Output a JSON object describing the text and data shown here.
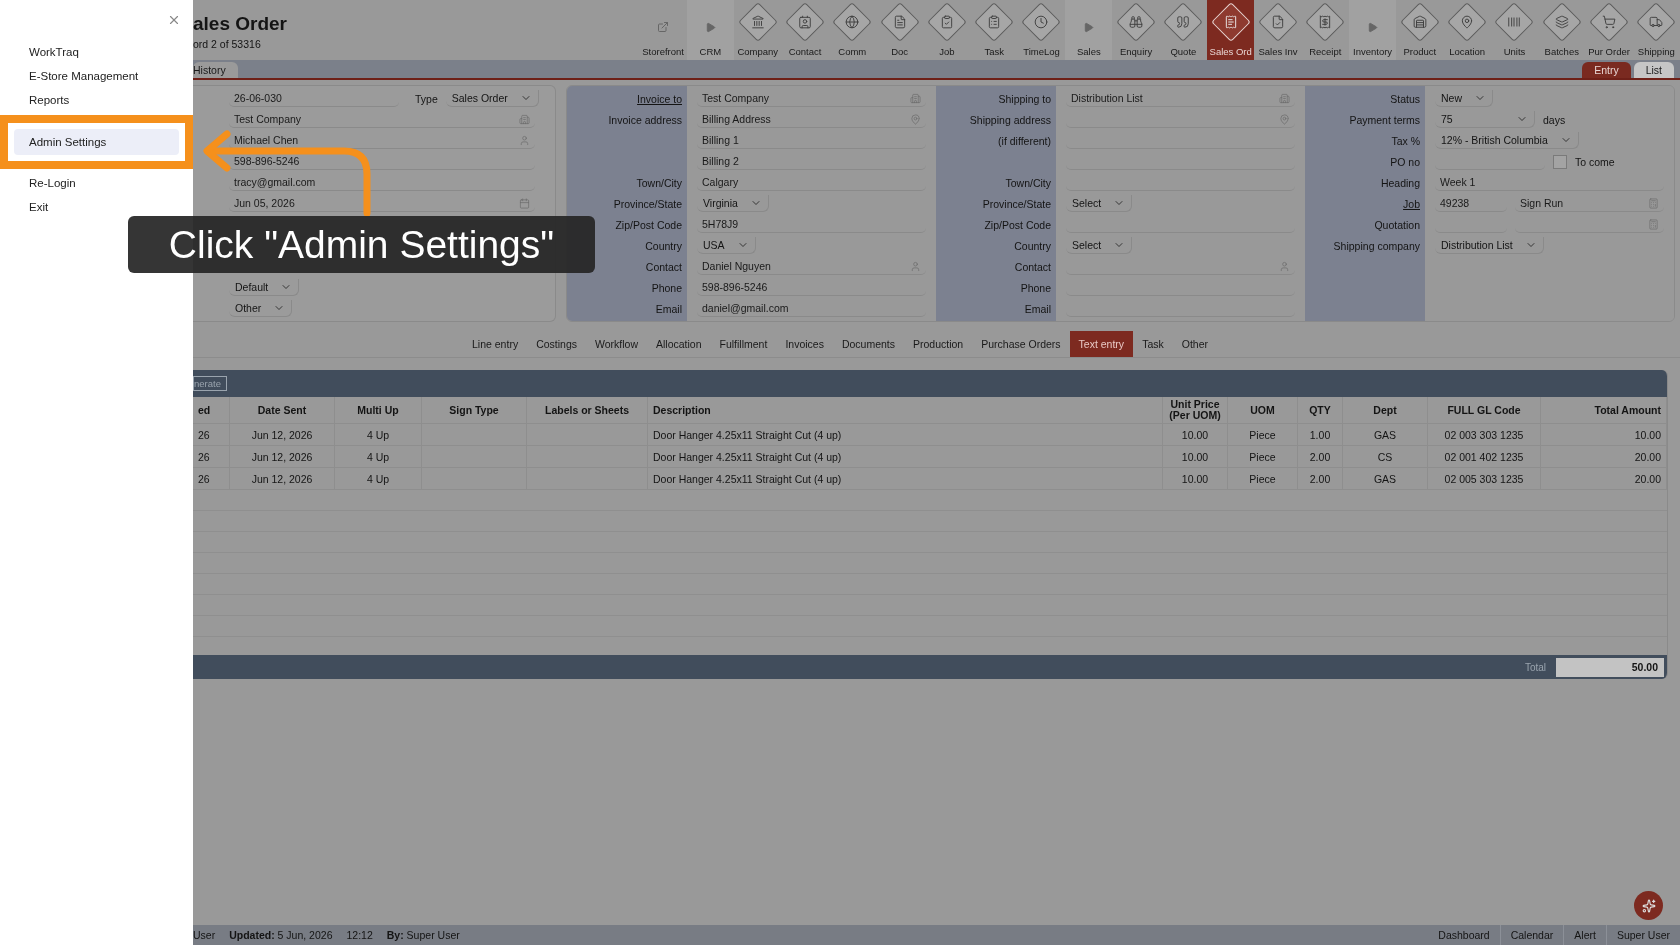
{
  "drawer": {
    "items": [
      {
        "label": "WorkTraq",
        "selected": false
      },
      {
        "label": "E-Store Management",
        "selected": false
      },
      {
        "label": "Reports",
        "selected": false
      },
      {
        "label": "Admin Settings",
        "selected": true
      },
      {
        "label": "Re-Login",
        "selected": false
      },
      {
        "label": "Exit",
        "selected": false
      }
    ]
  },
  "callout": {
    "text": "Click \"Admin Settings\""
  },
  "header": {
    "title": "ales Order",
    "subtitle": "ord 2 of 53316"
  },
  "toolbar": [
    {
      "label": "Storefront",
      "kind": "link",
      "selected": false
    },
    {
      "label": "CRM",
      "kind": "section",
      "selected": false
    },
    {
      "label": "Company",
      "kind": "module",
      "selected": false
    },
    {
      "label": "Contact",
      "kind": "module",
      "selected": false
    },
    {
      "label": "Comm",
      "kind": "module",
      "selected": false
    },
    {
      "label": "Doc",
      "kind": "module",
      "selected": false
    },
    {
      "label": "Job",
      "kind": "module",
      "selected": false
    },
    {
      "label": "Task",
      "kind": "module",
      "selected": false
    },
    {
      "label": "TimeLog",
      "kind": "module",
      "selected": false
    },
    {
      "label": "Sales",
      "kind": "section",
      "selected": false
    },
    {
      "label": "Enquiry",
      "kind": "module",
      "selected": false
    },
    {
      "label": "Quote",
      "kind": "module",
      "selected": false
    },
    {
      "label": "Sales Ord",
      "kind": "module",
      "selected": true
    },
    {
      "label": "Sales Inv",
      "kind": "module",
      "selected": false
    },
    {
      "label": "Receipt",
      "kind": "module",
      "selected": false
    },
    {
      "label": "Inventory",
      "kind": "section",
      "selected": false
    },
    {
      "label": "Product",
      "kind": "module",
      "selected": false
    },
    {
      "label": "Location",
      "kind": "module",
      "selected": false
    },
    {
      "label": "Units",
      "kind": "module",
      "selected": false
    },
    {
      "label": "Batches",
      "kind": "module",
      "selected": false
    },
    {
      "label": "Pur Order",
      "kind": "module",
      "selected": false
    },
    {
      "label": "Shipping",
      "kind": "module",
      "selected": false
    }
  ],
  "view_tabs": {
    "left": [
      {
        "label": "History",
        "selected": true
      }
    ],
    "right": [
      {
        "label": "Entry",
        "selected": true
      },
      {
        "label": "List",
        "selected": false
      }
    ]
  },
  "order_panel": {
    "rows": [
      {
        "kind": "field_select",
        "value": "26-06-030",
        "label": "Type",
        "option": "Sales Order"
      },
      {
        "kind": "lookup",
        "value": "Test Company"
      },
      {
        "kind": "contact",
        "value": "Michael Chen"
      },
      {
        "kind": "text",
        "value": "598-896-5246"
      },
      {
        "kind": "text",
        "value": "tracy@gmail.com"
      },
      {
        "kind": "date",
        "value": "Jun 05, 2026"
      }
    ],
    "footer_rows": [
      {
        "kind": "select",
        "value": "Default"
      },
      {
        "kind": "select",
        "value": "Other"
      }
    ]
  },
  "address_panels": [
    {
      "rows": [
        {
          "label": "Invoice to",
          "link": true,
          "kind": "lookup",
          "value": "Test Company"
        },
        {
          "label": "Invoice address",
          "link": false,
          "kind": "address",
          "value": "Billing Address"
        },
        {
          "kind": "text",
          "value": "Billing 1"
        },
        {
          "kind": "text",
          "value": "Billing 2"
        },
        {
          "label": "Town/City",
          "link": false,
          "kind": "text",
          "value": "Calgary"
        },
        {
          "label": "Province/State",
          "link": false,
          "kind": "select",
          "value": "Virginia"
        },
        {
          "label": "Zip/Post Code",
          "link": false,
          "kind": "text",
          "value": "5H78J9"
        },
        {
          "label": "Country",
          "link": false,
          "kind": "select",
          "value": "USA"
        },
        {
          "label": "Contact",
          "link": false,
          "kind": "contact",
          "value": "Daniel Nguyen"
        },
        {
          "label": "Phone",
          "link": false,
          "kind": "text",
          "value": "598-896-5246"
        },
        {
          "label": "Email",
          "link": false,
          "kind": "text",
          "value": "daniel@gmail.com"
        }
      ]
    },
    {
      "rows": [
        {
          "label": "Shipping to",
          "link": false,
          "kind": "lookup",
          "value": "Distribution List"
        },
        {
          "label": "Shipping address",
          "link": false,
          "kind": "address"
        },
        {
          "label": "(if different)",
          "link": false,
          "kind": "text"
        },
        {
          "kind": "text"
        },
        {
          "label": "Town/City",
          "link": false,
          "kind": "text"
        },
        {
          "label": "Province/State",
          "link": false,
          "kind": "select",
          "value": "Select"
        },
        {
          "label": "Zip/Post Code",
          "link": false,
          "kind": "text"
        },
        {
          "label": "Country",
          "link": false,
          "kind": "select",
          "value": "Select"
        },
        {
          "label": "Contact",
          "link": false,
          "kind": "contact"
        },
        {
          "label": "Phone",
          "link": false,
          "kind": "text"
        },
        {
          "label": "Email",
          "link": false,
          "kind": "text"
        }
      ]
    },
    {
      "rows": [
        {
          "label": "Status",
          "link": false,
          "kind": "select",
          "value": "New"
        },
        {
          "label": "Payment terms",
          "link": false,
          "kind": "select_suffix",
          "value": "75",
          "suffix": "days"
        },
        {
          "label": "Tax %",
          "link": false,
          "kind": "select",
          "value": "12% - British Columbia"
        },
        {
          "label": "PO no",
          "link": false,
          "kind": "check",
          "check_label": "To come",
          "checked": false
        },
        {
          "label": "Heading",
          "link": false,
          "kind": "text",
          "value": "Week 1"
        },
        {
          "label": "Job",
          "link": true,
          "kind": "pair",
          "value": "49238",
          "value_2": "Sign Run"
        },
        {
          "label": "Quotation",
          "link": false,
          "kind": "pair"
        },
        {
          "label": "Shipping company",
          "link": false,
          "kind": "select",
          "value": "Distribution List"
        }
      ]
    }
  ],
  "detail_tabs": [
    {
      "label": "Line entry",
      "selected": false
    },
    {
      "label": "Costings",
      "selected": false
    },
    {
      "label": "Workflow",
      "selected": false
    },
    {
      "label": "Allocation",
      "selected": false
    },
    {
      "label": "Fulfillment",
      "selected": false
    },
    {
      "label": "Invoices",
      "selected": false
    },
    {
      "label": "Documents",
      "selected": false
    },
    {
      "label": "Production",
      "selected": false
    },
    {
      "label": "Purchase Orders",
      "selected": false
    },
    {
      "label": "Text entry",
      "selected": true
    },
    {
      "label": "Task",
      "selected": false
    },
    {
      "label": "Other",
      "selected": false
    }
  ],
  "table": {
    "toolbar_button": "nerate",
    "columns": [
      "ed",
      "Date Sent",
      "Multi Up",
      "Sign Type",
      "Labels or Sheets",
      "Description",
      "Unit Price (Per UOM)",
      "UOM",
      "QTY",
      "Dept",
      "FULL GL Code",
      "Total Amount"
    ],
    "rows": [
      [
        "26",
        "Jun 12, 2026",
        "4 Up",
        null,
        null,
        "Door Hanger 4.25x11 Straight Cut (4 up)",
        "10.00",
        "Piece",
        "1.00",
        "GAS",
        "02 003 303 1235",
        "10.00"
      ],
      [
        "26",
        "Jun 12, 2026",
        "4 Up",
        null,
        null,
        "Door Hanger 4.25x11 Straight Cut (4 up)",
        "10.00",
        "Piece",
        "2.00",
        "CS",
        "02 001 402 1235",
        "20.00"
      ],
      [
        "26",
        "Jun 12, 2026",
        "4 Up",
        null,
        null,
        "Door Hanger 4.25x11 Straight Cut (4 up)",
        "10.00",
        "Piece",
        "2.00",
        "GAS",
        "02 005 303 1235",
        "20.00"
      ]
    ],
    "total_label": "Total",
    "total_value": "50.00"
  },
  "status_bar": {
    "left": [
      {
        "value": "User"
      },
      {
        "label": "Updated:",
        "value": "5 Jun, 2026"
      },
      {
        "value": "12:12"
      },
      {
        "label": "By:",
        "value": "Super User"
      }
    ],
    "right": [
      "Dashboard",
      "Calendar",
      "Alert",
      "Super User"
    ]
  }
}
